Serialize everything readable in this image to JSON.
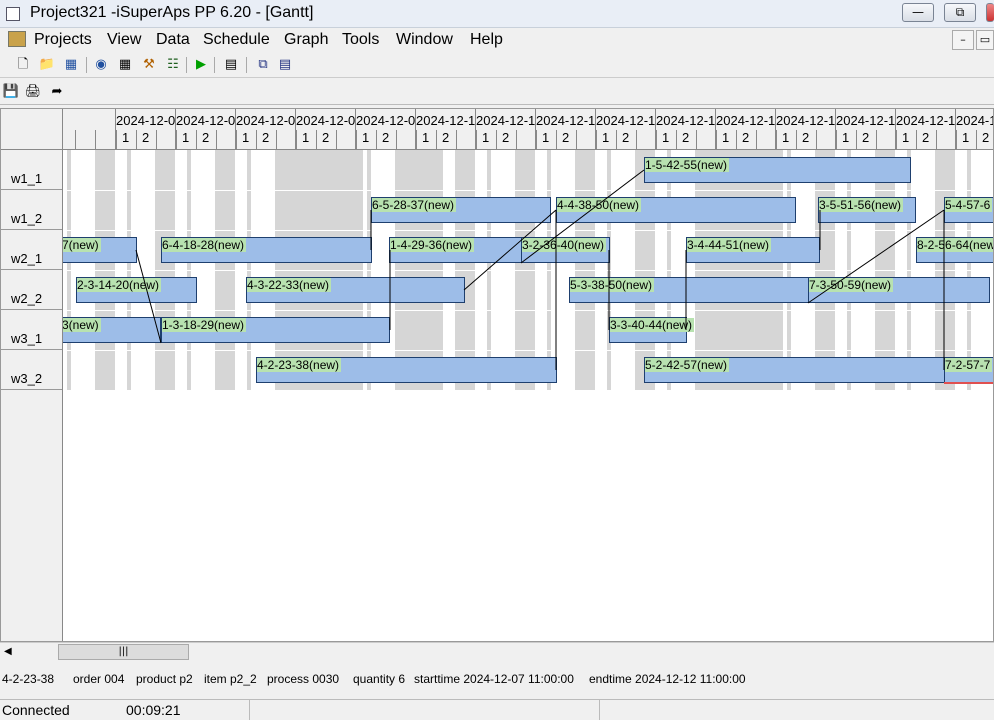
{
  "window": {
    "title": "Project321 -iSuperAps PP 6.20 - [Gantt]"
  },
  "menu": [
    "Projects",
    "View",
    "Data",
    "Schedule",
    "Graph",
    "Tools",
    "Window",
    "Help"
  ],
  "gantt": {
    "rows": [
      "w1_1",
      "w1_2",
      "w2_1",
      "w2_2",
      "w3_1",
      "w3_2"
    ],
    "days": [
      "2024-12-0",
      "2024-12-0",
      "2024-12-0",
      "2024-12-0",
      "2024-12-0",
      "2024-12-1",
      "2024-12-1",
      "2024-12-1",
      "2024-12-1",
      "2024-12-1",
      "2024-12-1",
      "2024-12-1",
      "2024-12-1",
      "2024-12-1",
      "2024-12-1"
    ],
    "shift_labels": [
      "1",
      "2"
    ],
    "bars": [
      {
        "label": "1-5-42-55(new)"
      },
      {
        "label": "6-5-28-37(new)"
      },
      {
        "label": "4-4-38-50(new)"
      },
      {
        "label": "3-5-51-56(new)"
      },
      {
        "label": "5-4-57-6"
      },
      {
        "label": "7(new)"
      },
      {
        "label": "6-4-18-28(new)"
      },
      {
        "label": "1-4-29-36(new)"
      },
      {
        "label": "3-2-36-40(new)"
      },
      {
        "label": "3-4-44-51(new)"
      },
      {
        "label": "8-2-56-64(new"
      },
      {
        "label": "2-3-14-20(new)"
      },
      {
        "label": "4-3-22-33(new)"
      },
      {
        "label": "5-3-38-50(new)"
      },
      {
        "label": "7-3-50-59(new)"
      },
      {
        "label": "3(new)"
      },
      {
        "label": "1-3-18-29(new)"
      },
      {
        "label": "3-3-40-44(new)"
      },
      {
        "label": "4-2-23-38(new)"
      },
      {
        "label": "5-2-42-57(new)"
      },
      {
        "label": "7-2-57-7"
      }
    ]
  },
  "info": {
    "id": "4-2-23-38",
    "order": "order 004",
    "product": "product p2",
    "item": "item p2_2",
    "process": "process 0030",
    "quantity": "quantity 6",
    "starttime": "starttime 2024-12-07 11:00:00",
    "endtime": "endtime 2024-12-12 11:00:00"
  },
  "status": {
    "connection": "Connected",
    "time": "00:09:21"
  },
  "colors": {
    "bar_fill": "#9dbde8",
    "bar_label": "#b8e2b0",
    "off_shift": "#d6d6d6"
  }
}
